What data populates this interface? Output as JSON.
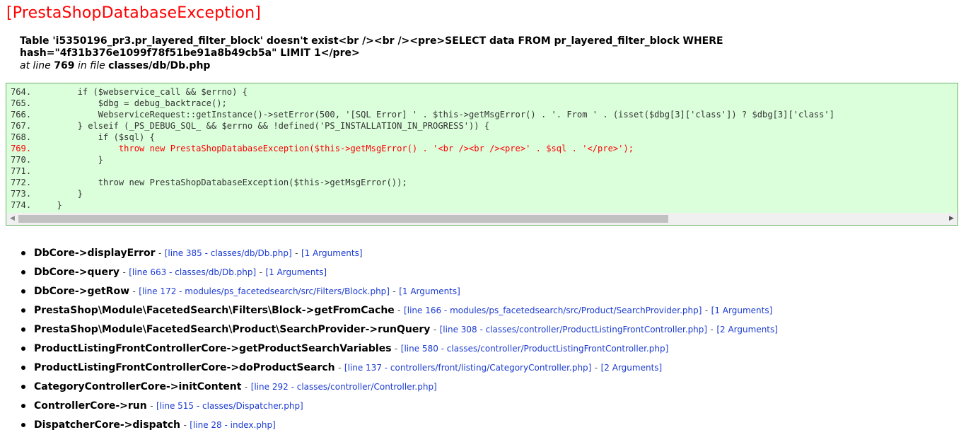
{
  "header": {
    "title": "[PrestaShopDatabaseException]",
    "message_line1": "Table 'i5350196_pr3.pr_layered_filter_block' doesn't exist<br /><br /><pre>SELECT data FROM pr_layered_filter_block WHERE",
    "message_line2": "hash=\"4f31b376e1099f78f51be91a8b49cb5a\" LIMIT 1</pre>",
    "at_line_prefix": "at line",
    "line_number": "769",
    "in_file_label": "in file",
    "file_path": "classes/db/Db.php"
  },
  "code": {
    "lines": [
      {
        "num": "764.",
        "text": "        if ($webservice_call && $errno) {",
        "highlight": false
      },
      {
        "num": "765.",
        "text": "            $dbg = debug_backtrace();",
        "highlight": false
      },
      {
        "num": "766.",
        "text": "            WebserviceRequest::getInstance()->setError(500, '[SQL Error] ' . $this->getMsgError() . '. From ' . (isset($dbg[3]['class']) ? $dbg[3]['class']",
        "highlight": false
      },
      {
        "num": "767.",
        "text": "        } elseif (_PS_DEBUG_SQL_ && $errno && !defined('PS_INSTALLATION_IN_PROGRESS')) {",
        "highlight": false
      },
      {
        "num": "768.",
        "text": "            if ($sql) {",
        "highlight": false
      },
      {
        "num": "769.",
        "text": "                throw new PrestaShopDatabaseException($this->getMsgError() . '<br /><br /><pre>' . $sql . '</pre>');",
        "highlight": true
      },
      {
        "num": "770.",
        "text": "            }",
        "highlight": false
      },
      {
        "num": "771.",
        "text": "",
        "highlight": false
      },
      {
        "num": "772.",
        "text": "            throw new PrestaShopDatabaseException($this->getMsgError());",
        "highlight": false
      },
      {
        "num": "773.",
        "text": "        }",
        "highlight": false
      },
      {
        "num": "774.",
        "text": "    }",
        "highlight": false
      }
    ],
    "colors": {
      "background": "#dbfedb",
      "border": "#6bb46b",
      "highlight": "#ff0000"
    },
    "scroll_left_icon": "chevron-left-icon",
    "scroll_right_icon": "chevron-right-icon"
  },
  "trace": [
    {
      "fn": "DbCore->displayError",
      "link": "[line 385 - classes/db/Db.php]",
      "args": "[1 Arguments]"
    },
    {
      "fn": "DbCore->query",
      "link": "[line 663 - classes/db/Db.php]",
      "args": "[1 Arguments]"
    },
    {
      "fn": "DbCore->getRow",
      "link": "[line 172 - modules/ps_facetedsearch/src/Filters/Block.php]",
      "args": "[1 Arguments]"
    },
    {
      "fn": "PrestaShop\\Module\\FacetedSearch\\Filters\\Block->getFromCache",
      "link": "[line 166 - modules/ps_facetedsearch/src/Product/SearchProvider.php]",
      "args": "[1 Arguments]"
    },
    {
      "fn": "PrestaShop\\Module\\FacetedSearch\\Product\\SearchProvider->runQuery",
      "link": "[line 308 - classes/controller/ProductListingFrontController.php]",
      "args": "[2 Arguments]"
    },
    {
      "fn": "ProductListingFrontControllerCore->getProductSearchVariables",
      "link": "[line 580 - classes/controller/ProductListingFrontController.php]",
      "args": ""
    },
    {
      "fn": "ProductListingFrontControllerCore->doProductSearch",
      "link": "[line 137 - controllers/front/listing/CategoryController.php]",
      "args": "[2 Arguments]"
    },
    {
      "fn": "CategoryControllerCore->initContent",
      "link": "[line 292 - classes/controller/Controller.php]",
      "args": ""
    },
    {
      "fn": "ControllerCore->run",
      "link": "[line 515 - classes/Dispatcher.php]",
      "args": ""
    },
    {
      "fn": "DispatcherCore->dispatch",
      "link": "[line 28 - index.php]",
      "args": ""
    }
  ],
  "separator": "-"
}
